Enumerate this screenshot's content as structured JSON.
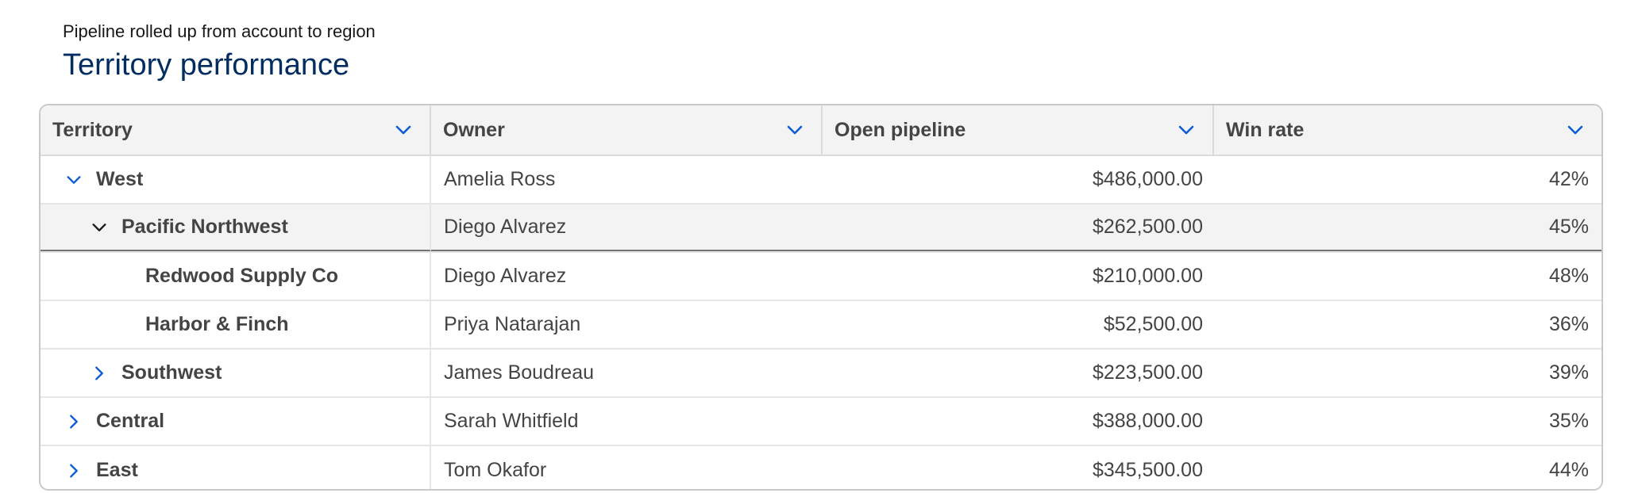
{
  "header": {
    "subtitle": "Pipeline rolled up from account to region",
    "title": "Territory performance"
  },
  "colors": {
    "accent": "#0b5cd5",
    "title": "#032d60",
    "header_bg": "#f3f3f3",
    "border": "#c9c9c9"
  },
  "columns": [
    {
      "label": "Territory",
      "icon": "chevron-down-icon"
    },
    {
      "label": "Owner",
      "icon": "chevron-down-icon"
    },
    {
      "label": "Open pipeline",
      "icon": "chevron-down-icon"
    },
    {
      "label": "Win rate",
      "icon": "chevron-down-icon"
    }
  ],
  "rows": [
    {
      "territory": "West",
      "owner": "Amelia Ross",
      "pipeline": "$486,000.00",
      "win_rate": "42%",
      "level": 1,
      "toggle": "expanded"
    },
    {
      "territory": "Pacific Northwest",
      "owner": "Diego Alvarez",
      "pipeline": "$262,500.00",
      "win_rate": "45%",
      "level": 2,
      "toggle": "expanded",
      "selected": true
    },
    {
      "territory": "Redwood Supply Co",
      "owner": "Diego Alvarez",
      "pipeline": "$210,000.00",
      "win_rate": "48%",
      "level": 3,
      "toggle": "none"
    },
    {
      "territory": "Harbor & Finch",
      "owner": "Priya Natarajan",
      "pipeline": "$52,500.00",
      "win_rate": "36%",
      "level": 3,
      "toggle": "none"
    },
    {
      "territory": "Southwest",
      "owner": "James Boudreau",
      "pipeline": "$223,500.00",
      "win_rate": "39%",
      "level": 2,
      "toggle": "collapsed"
    },
    {
      "territory": "Central",
      "owner": "Sarah Whitfield",
      "pipeline": "$388,000.00",
      "win_rate": "35%",
      "level": 1,
      "toggle": "collapsed"
    },
    {
      "territory": "East",
      "owner": "Tom Okafor",
      "pipeline": "$345,500.00",
      "win_rate": "44%",
      "level": 1,
      "toggle": "collapsed"
    }
  ]
}
